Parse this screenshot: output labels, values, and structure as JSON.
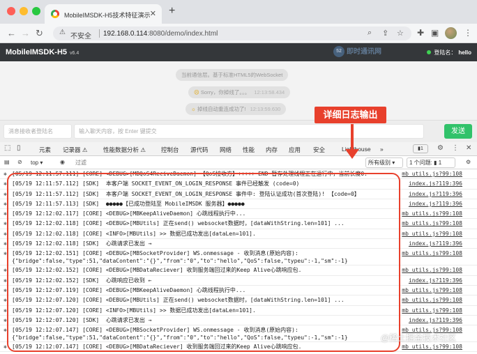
{
  "browser": {
    "tab_title": "MobileIMSDK-H5技术特征演示",
    "tab_close": "✕",
    "new_tab": "+",
    "security_label": "不安全",
    "url_host": "192.168.0.114",
    "url_rest": ":8080/demo/index.html",
    "icons": [
      "back-icon",
      "forward-icon",
      "reload-icon",
      "home-icon",
      "lock-icon",
      "zoom-icon",
      "share-icon",
      "star-icon",
      "puzzle-icon",
      "sidebar-icon",
      "menu-icon"
    ]
  },
  "app": {
    "title": "MobileIMSDK-H5",
    "version": "v6.4",
    "logo_text": "即时通讯网",
    "login_label": "登陆名：",
    "login_name": "hello",
    "status_color": "#3fd253"
  },
  "messages": [
    {
      "text": "当前通信层。基于标准HTML5的WebSocket",
      "icon": "",
      "time": ""
    },
    {
      "text": "Sorry，你掉线了。。。",
      "icon": "☹",
      "time": "12:13:58.434"
    },
    {
      "text": "掉线自动重连成功了!",
      "icon": "☼",
      "time": "12:13:59.630"
    }
  ],
  "input": {
    "to_placeholder": "消息接收者登陆名",
    "content_placeholder": "输入聊天内容，按 Enter 键提交",
    "send_label": "发送",
    "send_color": "#31c26a"
  },
  "devtools": {
    "tabs": [
      "元素",
      "记录器 ⚠",
      "性能数据分析 ⚠",
      "控制台",
      "源代码",
      "网络",
      "性能",
      "内存",
      "应用",
      "安全",
      "Lighthouse",
      "»"
    ],
    "active_tab": "控制台",
    "issue_count": "1",
    "context": "top",
    "filter_placeholder": "过滤",
    "levels": "所有级别 ▾",
    "issues_label": "1 个问题: ▮ 1"
  },
  "console": {
    "rows": [
      {
        "msg": "[05/19 12:11:57.111] [CORE] <DEBUG>[MBQoS4ReciveDaemon] 【QoS接收方】+++++ END 暂存处理线程正在运行中，当前长度0.",
        "src": "mb_utils.js?99:108"
      },
      {
        "msg": "[05/19 12:11:57.112] [SDK]  本客户端 SOCKET_EVENT_ON_LOGIN_RESPONSE 事件已经触发 (code=0)",
        "src": "index.js?119:396"
      },
      {
        "msg": "[05/19 12:11:57.112] [SDK]  本客户端 SOCKET_EVENT_ON_LOGIN_RESPONSE 事件中: 登陆认证成功(首次登陆)! 【code=0】",
        "src": "index.js?119:396"
      },
      {
        "msg": "[05/19 12:11:57.113] [SDK]  ●●●●●【已成功登陆至 MobileIMSDK 服务器】●●●●●",
        "src": "index.js?119:396"
      },
      {
        "msg": "[05/19 12:12:02.117] [CORE] <DEBUG>[MBKeepAliveDaemon] 心跳线程执行中...",
        "src": "mb_utils.js?99:108"
      },
      {
        "msg": "[05/19 12:12:02.118] [CORE] <DEBUG>[MBUtils] 正在send() websocket数据时，[dataWithString.len=101] ...",
        "src": "mb_utils.js?99:108"
      },
      {
        "msg": "[05/19 12:12:02.118] [CORE] <INFO>[MBUtils] >> 数据已成功发出[dataLen=101].",
        "src": "mb_utils.js?99:108"
      },
      {
        "msg": "[05/19 12:12:02.118] [SDK]  心跳请求已发出 →",
        "src": "index.js?119:396"
      },
      {
        "msg": "[05/19 12:12:02.151] [CORE] <DEBUG>[MBSocketProvider] WS.onmessage - 收到消息(原始内容):\n{\"bridge\":false,\"type\":51,\"dataContent\":\"{}\",\"from\":\"0\",\"to\":\"hello\",\"QoS\":false,\"typeu\":-1,\"sm\":-1}",
        "src": "mb_utils.js?99:108",
        "two": true
      },
      {
        "msg": "[05/19 12:12:02.152] [CORE] <DEBUG>[MBDataReciever] 收到服务端回过来的Keep Alive心跳响应包.",
        "src": "mb_utils.js?99:108"
      },
      {
        "msg": "[05/19 12:12:02.152] [SDK]  心跳响应已收到 ←",
        "src": "index.js?119:396"
      },
      {
        "msg": "[05/19 12:12:07.119] [CORE] <DEBUG>[MBKeepAliveDaemon] 心跳线程执行中...",
        "src": "mb_utils.js?99:108"
      },
      {
        "msg": "[05/19 12:12:07.120] [CORE] <DEBUG>[MBUtils] 正在send() websocket数据时，[dataWithString.len=101] ...",
        "src": "mb_utils.js?99:108"
      },
      {
        "msg": "[05/19 12:12:07.120] [CORE] <INFO>[MBUtils] >> 数据已成功发出[dataLen=101].",
        "src": "mb_utils.js?99:108"
      },
      {
        "msg": "[05/19 12:12:07.120] [SDK]  心跳请求已发出 →",
        "src": "index.js?119:396"
      },
      {
        "msg": "[05/19 12:12:07.147] [CORE] <DEBUG>[MBSocketProvider] WS.onmessage - 收到消息(原始内容):\n{\"bridge\":false,\"type\":51,\"dataContent\":\"{}\",\"from\":\"0\",\"to\":\"hello\",\"QoS\":false,\"typeu\":-1,\"sm\":-1}",
        "src": "mb_utils.js?99:108",
        "two": true
      },
      {
        "msg": "[05/19 12:12:07.147] [CORE] <DEBUG>[MBDataReciever] 收到服务端回过来的Keep Alive心跳响应包.",
        "src": "mb_utils.js?99:108"
      }
    ]
  },
  "annotation": {
    "callout": "详细日志输出",
    "color": "#e8402c"
  },
  "watermark": "@稀土掘金技术社区"
}
